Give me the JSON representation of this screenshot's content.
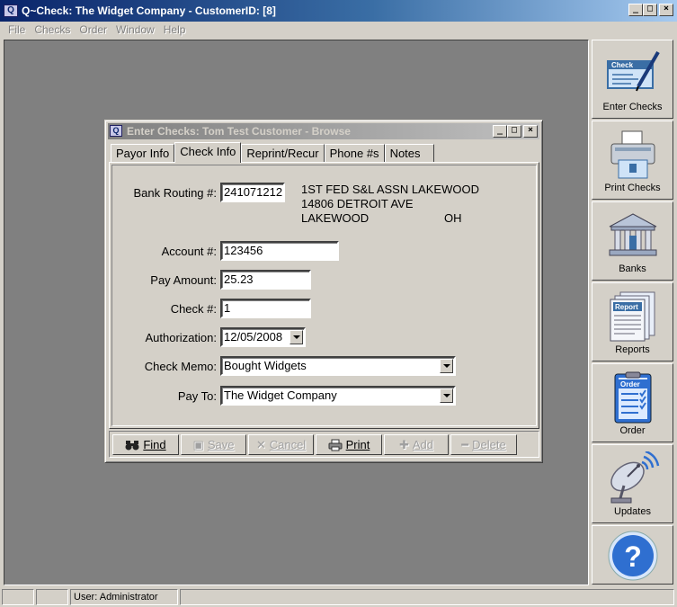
{
  "window": {
    "title": "Q~Check: The Widget Company - CustomerID: [8]",
    "icon_letter": "Q",
    "minimize": "_",
    "maximize": "□",
    "close": "×"
  },
  "menu": [
    "File",
    "Checks",
    "Order",
    "Window",
    "Help"
  ],
  "sidebar": {
    "items": [
      {
        "label": "Enter Checks",
        "icon": "check-pen-icon",
        "badge": "Check"
      },
      {
        "label": "Print Checks",
        "icon": "printer-icon"
      },
      {
        "label": "Banks",
        "icon": "bank-building-icon"
      },
      {
        "label": "Reports",
        "icon": "reports-icon",
        "badge": "Report"
      },
      {
        "label": "Order",
        "icon": "order-clipboard-icon",
        "badge": "Order"
      },
      {
        "label": "Updates",
        "icon": "satellite-dish-icon"
      },
      {
        "label": "",
        "icon": "help-question-icon",
        "badge": "?"
      }
    ]
  },
  "dialog": {
    "title": "Enter Checks: Tom Test Customer - Browse",
    "tabs": [
      "Payor Info",
      "Check Info",
      "Reprint/Recur",
      "Phone #s",
      "Notes"
    ],
    "active_tab": "Check Info",
    "form": {
      "routing_label": "Bank Routing #:",
      "routing_value": "241071212",
      "bank_name": "1ST FED S&L ASSN LAKEWOOD",
      "bank_address": "14806 DETROIT AVE",
      "bank_city": "LAKEWOOD",
      "bank_state": "OH",
      "account_label": "Account #:",
      "account_value": "123456",
      "amount_label": "Pay Amount:",
      "amount_value": "25.23",
      "check_label": "Check #:",
      "check_value": "1",
      "auth_label": "Authorization:",
      "auth_value": "12/05/2008",
      "memo_label": "Check Memo:",
      "memo_value": "Bought Widgets",
      "payto_label": "Pay To:",
      "payto_value": "The Widget Company"
    },
    "toolbar": {
      "find": {
        "label": "Find",
        "icon": "binoculars-icon",
        "enabled": true
      },
      "save": {
        "label": "Save",
        "icon": "floppy-disk-icon",
        "enabled": false
      },
      "cancel": {
        "label": "Cancel",
        "icon": "x-cancel-icon",
        "enabled": false
      },
      "print": {
        "label": "Print",
        "icon": "printer-icon",
        "enabled": true
      },
      "add": {
        "label": "Add",
        "icon": "plus-icon",
        "enabled": false
      },
      "delete": {
        "label": "Delete",
        "icon": "minus-icon",
        "enabled": false
      }
    }
  },
  "status": {
    "user": "User: Administrator"
  },
  "colors": {
    "title_active": "#0a246a",
    "title_inactive": "#808080",
    "mdi_background": "#808080",
    "face": "#d4d0c8"
  }
}
